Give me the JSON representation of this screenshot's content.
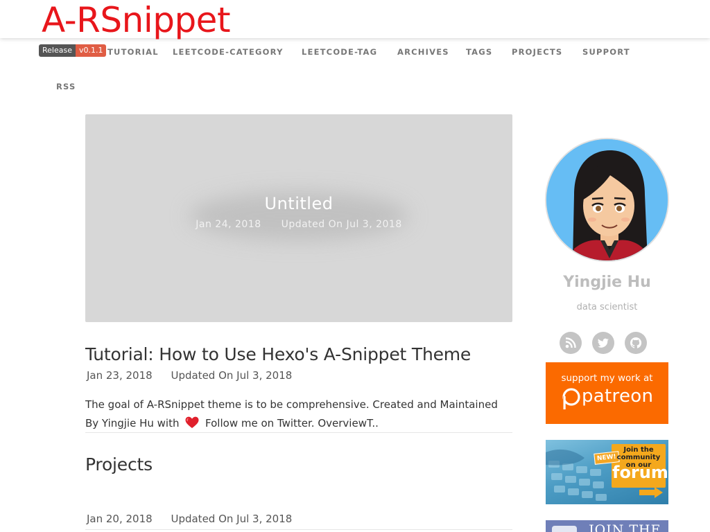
{
  "site": {
    "title": "A-RSnippet",
    "badge_left": "Release",
    "badge_right": "v0.1.1",
    "brand_color": "#e8161b"
  },
  "nav": {
    "items": [
      {
        "label": "TUTORIAL"
      },
      {
        "label": "LEETCODE-CATEGORY"
      },
      {
        "label": "LEETCODE-TAG"
      },
      {
        "label": "ARCHIVES"
      },
      {
        "label": "TAGS"
      },
      {
        "label": "PROJECTS"
      },
      {
        "label": "SUPPORT"
      },
      {
        "label": "RSS"
      }
    ]
  },
  "featured": {
    "title": "Untitled",
    "date": "Jan 24, 2018",
    "updated": "Updated On Jul 3, 2018"
  },
  "posts": [
    {
      "title": "Tutorial: How to Use Hexo's A-Snippet Theme",
      "date": "Jan 23, 2018",
      "updated": "Updated On Jul 3, 2018",
      "excerpt_before": "The goal of A-RSnippet theme is to be comprehensive. Created and Maintained By Yingjie Hu with",
      "excerpt_after": "Follow me on Twitter. OverviewT.."
    },
    {
      "title": "Projects",
      "date": "Jan 20, 2018",
      "updated": "Updated On Jul 3, 2018"
    }
  ],
  "sidebar": {
    "author_name": "Yingjie Hu",
    "author_role": "data scientist",
    "social_icons": [
      "rss-icon",
      "twitter-icon",
      "github-icon"
    ],
    "patreon": {
      "tagline": "support my work at",
      "brand": "patreon",
      "color": "#fb6a00"
    },
    "forum": {
      "badge": "NEW!",
      "join_text": "Join the community on our",
      "word": "forum"
    },
    "join_banner": {
      "text": "JOIN THE"
    }
  }
}
